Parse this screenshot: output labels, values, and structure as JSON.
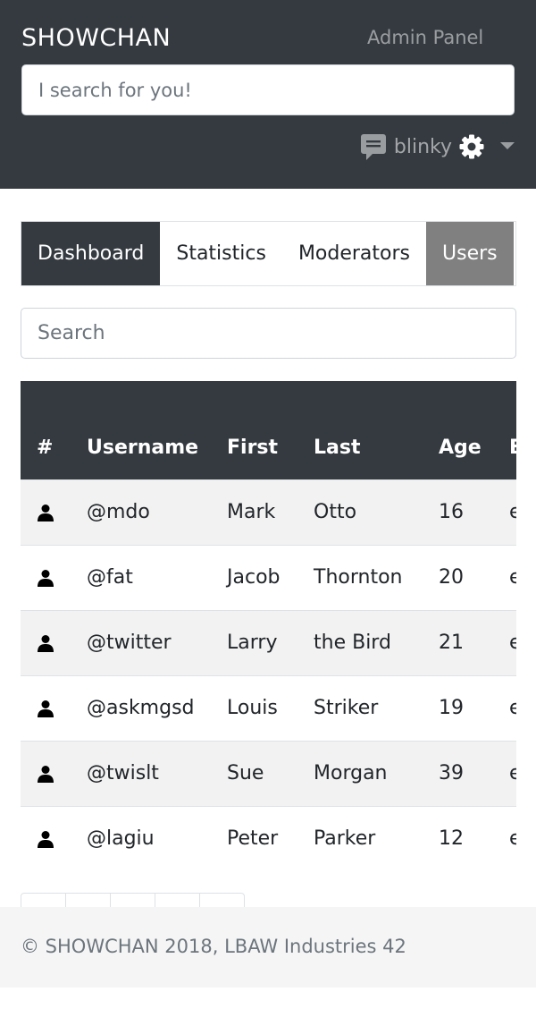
{
  "navbar": {
    "brand": "SHOWCHAN",
    "admin_link": "Admin Panel",
    "search_placeholder": "I search for you!",
    "username": "blinky",
    "icons": [
      "chat-icon",
      "gear-icon",
      "caret-down-icon"
    ]
  },
  "tabs": [
    {
      "label": "Dashboard",
      "state": "dark"
    },
    {
      "label": "Statistics",
      "state": "normal"
    },
    {
      "label": "Moderators",
      "state": "normal"
    },
    {
      "label": "Users",
      "state": "selected"
    }
  ],
  "search": {
    "placeholder": "Search"
  },
  "table": {
    "headers": [
      "#",
      "Username",
      "First",
      "Last",
      "Age",
      "E"
    ],
    "rows": [
      {
        "username": "@mdo",
        "first": "Mark",
        "last": "Otto",
        "age": "16",
        "email": "e"
      },
      {
        "username": "@fat",
        "first": "Jacob",
        "last": "Thornton",
        "age": "20",
        "email": "e"
      },
      {
        "username": "@twitter",
        "first": "Larry",
        "last": "the Bird",
        "age": "21",
        "email": "e"
      },
      {
        "username": "@askmgsd",
        "first": "Louis",
        "last": "Striker",
        "age": "19",
        "email": "e"
      },
      {
        "username": "@twislt",
        "first": "Sue",
        "last": "Morgan",
        "age": "39",
        "email": "e"
      },
      {
        "username": "@lagiu",
        "first": "Peter",
        "last": "Parker",
        "age": "12",
        "email": "e"
      }
    ]
  },
  "footer": {
    "text": "© SHOWCHAN 2018, LBAW Industries 42"
  },
  "colors": {
    "navbar_bg": "#343a40",
    "tab_selected": "#808080",
    "row_striped": "#f2f2f2",
    "footer_bg": "#f5f5f5"
  }
}
